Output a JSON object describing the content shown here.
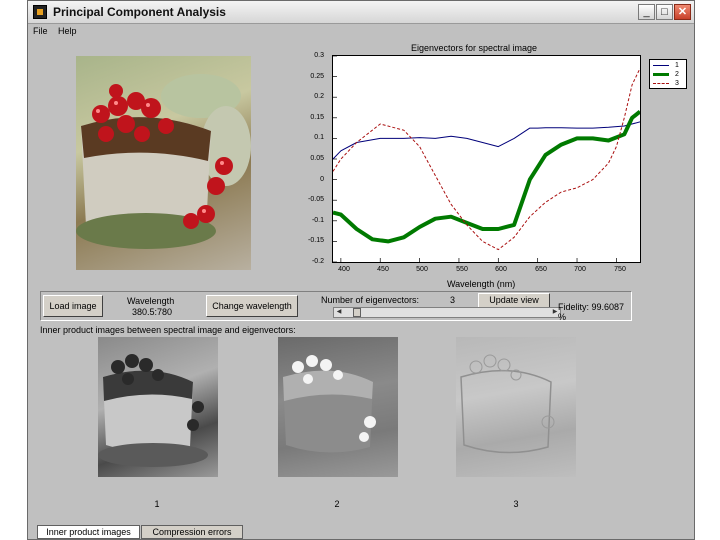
{
  "window": {
    "title": "Principal Component Analysis"
  },
  "menu": [
    "File",
    "Help"
  ],
  "plot": {
    "title": "Eigenvectors for spectral image",
    "xlabel": "Wavelength (nm)",
    "ytick_labels": [
      "0.3",
      "0.25",
      "0.2",
      "0.15",
      "0.1",
      "0.05",
      "0",
      "-0.05",
      "-0.1",
      "-0.15",
      "-0.2"
    ],
    "xtick_labels": [
      "400",
      "450",
      "500",
      "550",
      "600",
      "650",
      "700",
      "750"
    ]
  },
  "chart_data": {
    "type": "line",
    "title": "Eigenvectors for spectral image",
    "xlabel": "Wavelength (nm)",
    "ylabel": "",
    "xlim": [
      390,
      780
    ],
    "ylim": [
      -0.2,
      0.3
    ],
    "xticks": [
      400,
      450,
      500,
      550,
      600,
      650,
      700,
      750
    ],
    "yticks": [
      0.3,
      0.25,
      0.2,
      0.15,
      0.1,
      0.05,
      0,
      -0.05,
      -0.1,
      -0.15,
      -0.2
    ],
    "legend_position": "outside-right",
    "series": [
      {
        "name": "1",
        "color": "#00007a",
        "x": [
          390,
          400,
          420,
          450,
          480,
          500,
          520,
          540,
          560,
          580,
          600,
          620,
          640,
          650,
          660,
          680,
          700,
          720,
          740,
          760,
          780
        ],
        "y": [
          0.05,
          0.07,
          0.09,
          0.1,
          0.1,
          0.102,
          0.1,
          0.105,
          0.1,
          0.09,
          0.08,
          0.1,
          0.125,
          0.125,
          0.126,
          0.126,
          0.125,
          0.125,
          0.127,
          0.13,
          0.14
        ]
      },
      {
        "name": "2",
        "color": "#007a00",
        "x": [
          390,
          400,
          420,
          440,
          460,
          480,
          500,
          520,
          540,
          560,
          580,
          600,
          620,
          640,
          650,
          660,
          680,
          700,
          720,
          740,
          760,
          770,
          780
        ],
        "y": [
          -0.08,
          -0.085,
          -0.12,
          -0.145,
          -0.15,
          -0.14,
          -0.115,
          -0.095,
          -0.09,
          -0.105,
          -0.12,
          -0.12,
          -0.11,
          0.0,
          0.03,
          0.06,
          0.085,
          0.1,
          0.1,
          0.095,
          0.11,
          0.15,
          0.165
        ]
      },
      {
        "name": "3",
        "color": "#aa1010",
        "x": [
          390,
          400,
          420,
          450,
          480,
          500,
          520,
          540,
          560,
          580,
          600,
          620,
          640,
          660,
          680,
          700,
          720,
          740,
          750,
          760,
          770,
          780
        ],
        "y": [
          0.02,
          0.05,
          0.09,
          0.135,
          0.12,
          0.08,
          0.01,
          -0.06,
          -0.11,
          -0.15,
          -0.17,
          -0.14,
          -0.09,
          -0.055,
          -0.03,
          -0.02,
          0.0,
          0.04,
          0.08,
          0.15,
          0.23,
          0.27
        ]
      }
    ]
  },
  "controls": {
    "load_button": "Load image",
    "wavelength_label": "Wavelength",
    "wavelength_value": "380.5:780",
    "change_button": "Change wavelength",
    "num_eig_label": "Number of eigenvectors:",
    "num_eig_value": "3",
    "update_button": "Update view",
    "fidelity": "Fidelity: 99.6087 %",
    "slider_value": 3
  },
  "inner_caption": "Inner product images between spectral image and eigenvectors:",
  "thumbnail_labels": [
    "1",
    "2",
    "3"
  ],
  "tabs": [
    "Inner product images",
    "Compression errors"
  ],
  "colors": {
    "window_bg": "#c0c0c0",
    "series_1": "#00007a",
    "series_2": "#007a00",
    "series_3": "#aa1010"
  }
}
